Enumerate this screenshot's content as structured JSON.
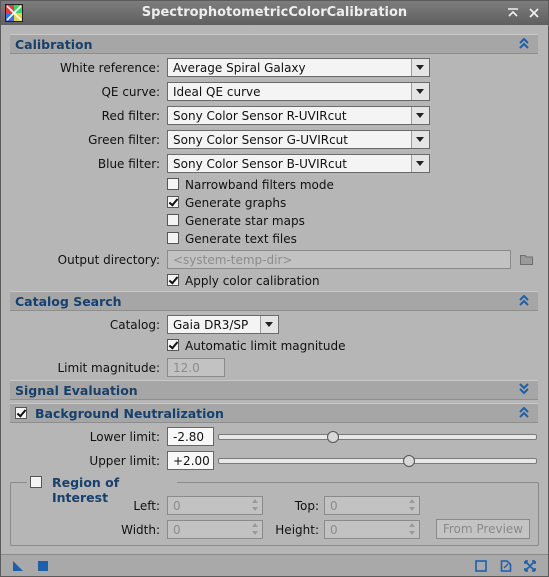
{
  "window": {
    "title": "SpectrophotometricColorCalibration",
    "icons": [
      "app-icon",
      "collapse-icon",
      "close-icon"
    ]
  },
  "calibration": {
    "title": "Calibration",
    "white_reference": {
      "label": "White reference:",
      "value": "Average Spiral Galaxy"
    },
    "qe_curve": {
      "label": "QE curve:",
      "value": "Ideal QE curve"
    },
    "red_filter": {
      "label": "Red filter:",
      "value": "Sony Color Sensor R-UVIRcut"
    },
    "green_filter": {
      "label": "Green filter:",
      "value": "Sony Color Sensor G-UVIRcut"
    },
    "blue_filter": {
      "label": "Blue filter:",
      "value": "Sony Color Sensor B-UVIRcut"
    },
    "narrowband": {
      "label": "Narrowband filters mode",
      "checked": false
    },
    "generate_graphs": {
      "label": "Generate graphs",
      "checked": true
    },
    "generate_star_maps": {
      "label": "Generate star maps",
      "checked": false
    },
    "generate_text_files": {
      "label": "Generate text files",
      "checked": false
    },
    "output_directory": {
      "label": "Output directory:",
      "placeholder": "<system-temp-dir>"
    },
    "apply_color_calibration": {
      "label": "Apply color calibration",
      "checked": true
    }
  },
  "catalog_search": {
    "title": "Catalog Search",
    "catalog": {
      "label": "Catalog:",
      "value": "Gaia DR3/SP"
    },
    "auto_limit": {
      "label": "Automatic limit magnitude",
      "checked": true
    },
    "limit_magnitude": {
      "label": "Limit magnitude:",
      "value": "12.0"
    }
  },
  "signal_evaluation": {
    "title": "Signal Evaluation"
  },
  "background_neutralization": {
    "title": "Background Neutralization",
    "enabled": true,
    "lower_limit": {
      "label": "Lower limit:",
      "value": "-2.80",
      "slider_fraction": 0.36
    },
    "upper_limit": {
      "label": "Upper limit:",
      "value": "+2.00",
      "slider_fraction": 0.6
    }
  },
  "region_of_interest": {
    "title": "Region of Interest",
    "enabled": false,
    "left": {
      "label": "Left:",
      "value": "0"
    },
    "top": {
      "label": "Top:",
      "value": "0"
    },
    "width": {
      "label": "Width:",
      "value": "0"
    },
    "height": {
      "label": "Height:",
      "value": "0"
    },
    "from_preview": "From Preview"
  },
  "colors": {
    "section_title": "#17406c",
    "panel_bg": "#b6b6b6",
    "title_bar": "#6e6e6e",
    "accent_icon": "#1f5fa8"
  }
}
